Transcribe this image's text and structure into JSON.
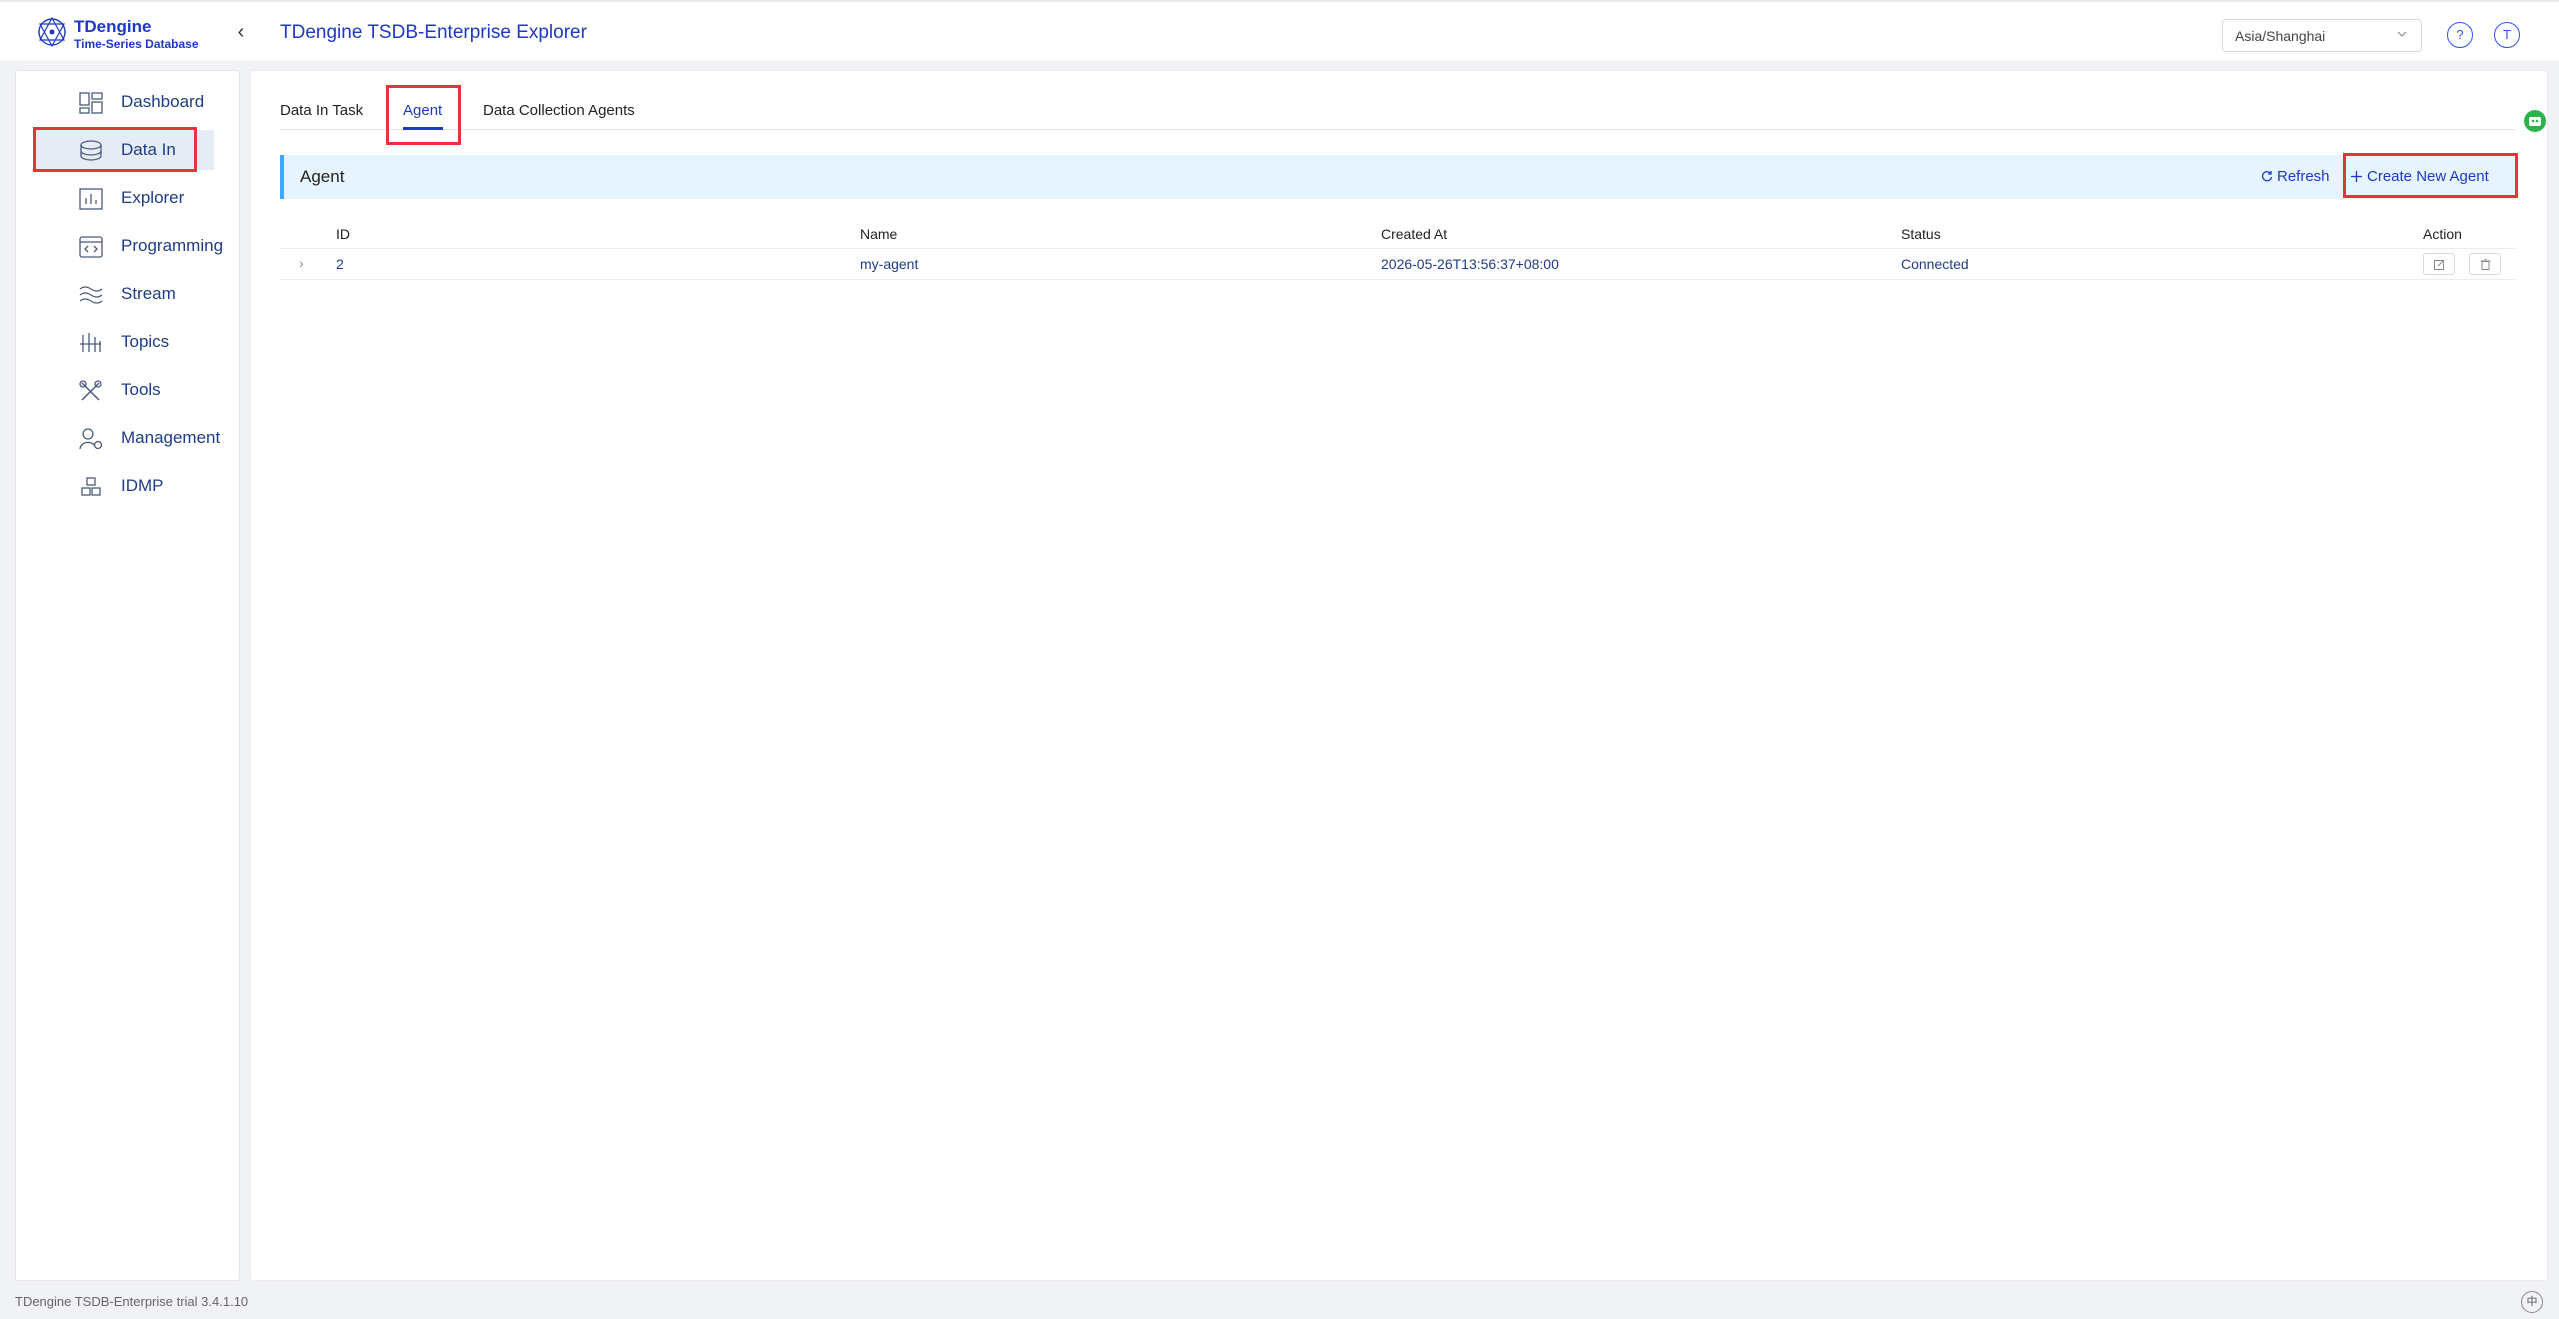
{
  "brand": {
    "name": "TDengine",
    "subtitle": "Time-Series Database"
  },
  "header": {
    "app_title": "TDengine TSDB-Enterprise Explorer",
    "timezone": "Asia/Shanghai",
    "help_label": "?",
    "user_initial": "T"
  },
  "sidebar": {
    "items": [
      {
        "label": "Dashboard",
        "icon": "dashboard-icon",
        "active": false
      },
      {
        "label": "Data In",
        "icon": "database-icon",
        "active": true
      },
      {
        "label": "Explorer",
        "icon": "chart-icon",
        "active": false
      },
      {
        "label": "Programming",
        "icon": "code-icon",
        "active": false
      },
      {
        "label": "Stream",
        "icon": "stream-icon",
        "active": false
      },
      {
        "label": "Topics",
        "icon": "topics-icon",
        "active": false
      },
      {
        "label": "Tools",
        "icon": "tools-icon",
        "active": false
      },
      {
        "label": "Management",
        "icon": "user-gear-icon",
        "active": false
      },
      {
        "label": "IDMP",
        "icon": "cubes-icon",
        "active": false
      }
    ]
  },
  "tabs": [
    {
      "label": "Data In Task",
      "active": false
    },
    {
      "label": "Agent",
      "active": true
    },
    {
      "label": "Data Collection Agents",
      "active": false
    }
  ],
  "section": {
    "title": "Agent",
    "refresh_label": "Refresh",
    "create_label": "Create New Agent"
  },
  "table": {
    "columns": [
      "ID",
      "Name",
      "Created At",
      "Status",
      "Action"
    ],
    "rows": [
      {
        "id": "2",
        "name": "my-agent",
        "created_at": "2026-05-26T13:56:37+08:00",
        "status": "Connected"
      }
    ]
  },
  "footer": {
    "version_text": "TDengine TSDB-Enterprise trial 3.4.1.10",
    "lang_label": "中"
  },
  "colors": {
    "accent": "#1d39c4",
    "highlight": "#e8323c",
    "section_bg": "#e6f4ff"
  }
}
